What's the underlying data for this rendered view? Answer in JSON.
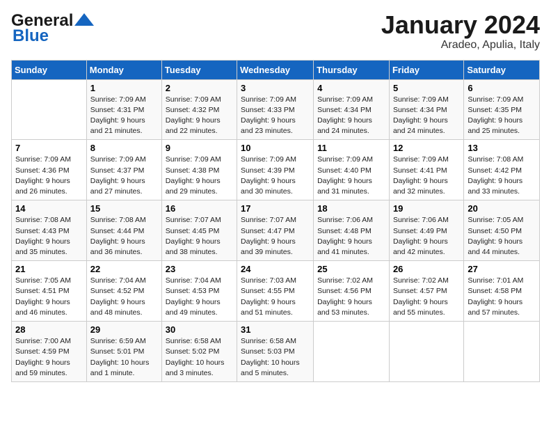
{
  "logo": {
    "line1": "General",
    "line2": "Blue"
  },
  "header": {
    "month": "January 2024",
    "location": "Aradeo, Apulia, Italy"
  },
  "weekdays": [
    "Sunday",
    "Monday",
    "Tuesday",
    "Wednesday",
    "Thursday",
    "Friday",
    "Saturday"
  ],
  "weeks": [
    [
      {
        "day": "",
        "info": ""
      },
      {
        "day": "1",
        "info": "Sunrise: 7:09 AM\nSunset: 4:31 PM\nDaylight: 9 hours\nand 21 minutes."
      },
      {
        "day": "2",
        "info": "Sunrise: 7:09 AM\nSunset: 4:32 PM\nDaylight: 9 hours\nand 22 minutes."
      },
      {
        "day": "3",
        "info": "Sunrise: 7:09 AM\nSunset: 4:33 PM\nDaylight: 9 hours\nand 23 minutes."
      },
      {
        "day": "4",
        "info": "Sunrise: 7:09 AM\nSunset: 4:34 PM\nDaylight: 9 hours\nand 24 minutes."
      },
      {
        "day": "5",
        "info": "Sunrise: 7:09 AM\nSunset: 4:34 PM\nDaylight: 9 hours\nand 24 minutes."
      },
      {
        "day": "6",
        "info": "Sunrise: 7:09 AM\nSunset: 4:35 PM\nDaylight: 9 hours\nand 25 minutes."
      }
    ],
    [
      {
        "day": "7",
        "info": "Sunrise: 7:09 AM\nSunset: 4:36 PM\nDaylight: 9 hours\nand 26 minutes."
      },
      {
        "day": "8",
        "info": "Sunrise: 7:09 AM\nSunset: 4:37 PM\nDaylight: 9 hours\nand 27 minutes."
      },
      {
        "day": "9",
        "info": "Sunrise: 7:09 AM\nSunset: 4:38 PM\nDaylight: 9 hours\nand 29 minutes."
      },
      {
        "day": "10",
        "info": "Sunrise: 7:09 AM\nSunset: 4:39 PM\nDaylight: 9 hours\nand 30 minutes."
      },
      {
        "day": "11",
        "info": "Sunrise: 7:09 AM\nSunset: 4:40 PM\nDaylight: 9 hours\nand 31 minutes."
      },
      {
        "day": "12",
        "info": "Sunrise: 7:09 AM\nSunset: 4:41 PM\nDaylight: 9 hours\nand 32 minutes."
      },
      {
        "day": "13",
        "info": "Sunrise: 7:08 AM\nSunset: 4:42 PM\nDaylight: 9 hours\nand 33 minutes."
      }
    ],
    [
      {
        "day": "14",
        "info": "Sunrise: 7:08 AM\nSunset: 4:43 PM\nDaylight: 9 hours\nand 35 minutes."
      },
      {
        "day": "15",
        "info": "Sunrise: 7:08 AM\nSunset: 4:44 PM\nDaylight: 9 hours\nand 36 minutes."
      },
      {
        "day": "16",
        "info": "Sunrise: 7:07 AM\nSunset: 4:45 PM\nDaylight: 9 hours\nand 38 minutes."
      },
      {
        "day": "17",
        "info": "Sunrise: 7:07 AM\nSunset: 4:47 PM\nDaylight: 9 hours\nand 39 minutes."
      },
      {
        "day": "18",
        "info": "Sunrise: 7:06 AM\nSunset: 4:48 PM\nDaylight: 9 hours\nand 41 minutes."
      },
      {
        "day": "19",
        "info": "Sunrise: 7:06 AM\nSunset: 4:49 PM\nDaylight: 9 hours\nand 42 minutes."
      },
      {
        "day": "20",
        "info": "Sunrise: 7:05 AM\nSunset: 4:50 PM\nDaylight: 9 hours\nand 44 minutes."
      }
    ],
    [
      {
        "day": "21",
        "info": "Sunrise: 7:05 AM\nSunset: 4:51 PM\nDaylight: 9 hours\nand 46 minutes."
      },
      {
        "day": "22",
        "info": "Sunrise: 7:04 AM\nSunset: 4:52 PM\nDaylight: 9 hours\nand 48 minutes."
      },
      {
        "day": "23",
        "info": "Sunrise: 7:04 AM\nSunset: 4:53 PM\nDaylight: 9 hours\nand 49 minutes."
      },
      {
        "day": "24",
        "info": "Sunrise: 7:03 AM\nSunset: 4:55 PM\nDaylight: 9 hours\nand 51 minutes."
      },
      {
        "day": "25",
        "info": "Sunrise: 7:02 AM\nSunset: 4:56 PM\nDaylight: 9 hours\nand 53 minutes."
      },
      {
        "day": "26",
        "info": "Sunrise: 7:02 AM\nSunset: 4:57 PM\nDaylight: 9 hours\nand 55 minutes."
      },
      {
        "day": "27",
        "info": "Sunrise: 7:01 AM\nSunset: 4:58 PM\nDaylight: 9 hours\nand 57 minutes."
      }
    ],
    [
      {
        "day": "28",
        "info": "Sunrise: 7:00 AM\nSunset: 4:59 PM\nDaylight: 9 hours\nand 59 minutes."
      },
      {
        "day": "29",
        "info": "Sunrise: 6:59 AM\nSunset: 5:01 PM\nDaylight: 10 hours\nand 1 minute."
      },
      {
        "day": "30",
        "info": "Sunrise: 6:58 AM\nSunset: 5:02 PM\nDaylight: 10 hours\nand 3 minutes."
      },
      {
        "day": "31",
        "info": "Sunrise: 6:58 AM\nSunset: 5:03 PM\nDaylight: 10 hours\nand 5 minutes."
      },
      {
        "day": "",
        "info": ""
      },
      {
        "day": "",
        "info": ""
      },
      {
        "day": "",
        "info": ""
      }
    ]
  ]
}
